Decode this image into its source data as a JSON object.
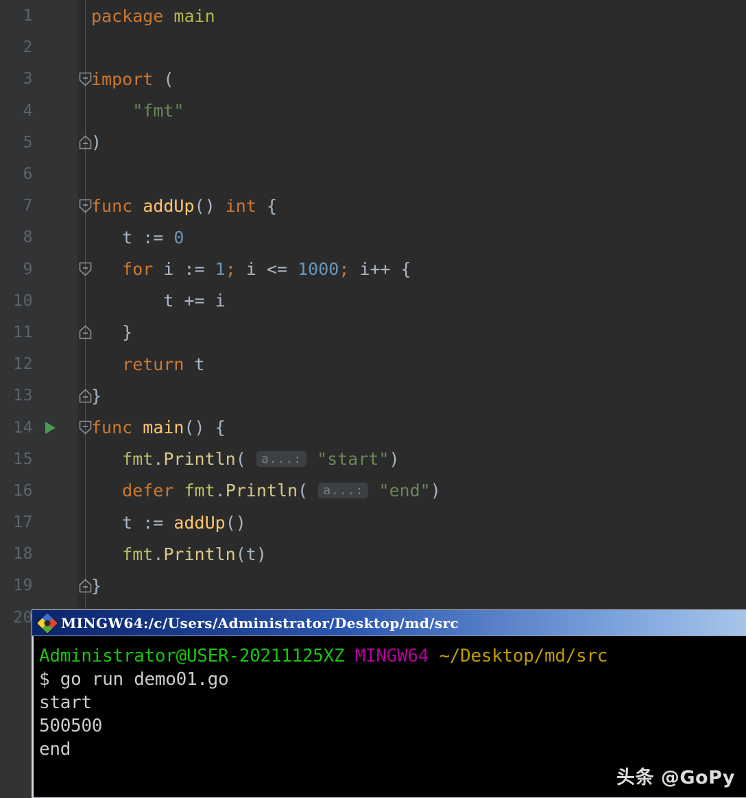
{
  "editor": {
    "language": "Go",
    "background": "#2b2b2b",
    "gutter_background": "#313335",
    "line_number_color": "#606366",
    "run_marker_color": "#499c54",
    "lines": [
      {
        "n": "1",
        "fold": "none",
        "run": false
      },
      {
        "n": "2",
        "fold": "none",
        "run": false
      },
      {
        "n": "3",
        "fold": "start",
        "run": false
      },
      {
        "n": "4",
        "fold": "none",
        "run": false
      },
      {
        "n": "5",
        "fold": "end",
        "run": false
      },
      {
        "n": "6",
        "fold": "none",
        "run": false
      },
      {
        "n": "7",
        "fold": "start",
        "run": false
      },
      {
        "n": "8",
        "fold": "none",
        "run": false
      },
      {
        "n": "9",
        "fold": "start",
        "run": false
      },
      {
        "n": "10",
        "fold": "none",
        "run": false
      },
      {
        "n": "11",
        "fold": "end",
        "run": false
      },
      {
        "n": "12",
        "fold": "none",
        "run": false
      },
      {
        "n": "13",
        "fold": "end",
        "run": false
      },
      {
        "n": "14",
        "fold": "start",
        "run": true
      },
      {
        "n": "15",
        "fold": "none",
        "run": false
      },
      {
        "n": "16",
        "fold": "none",
        "run": false
      },
      {
        "n": "17",
        "fold": "none",
        "run": false
      },
      {
        "n": "18",
        "fold": "none",
        "run": false
      },
      {
        "n": "19",
        "fold": "end",
        "run": false
      },
      {
        "n": "20",
        "fold": "none",
        "run": false
      }
    ],
    "source_text": "package main\n\nimport (\n    \"fmt\"\n)\n\nfunc addUp() int {\n    t := 0\n    for i := 1; i <= 1000; i++ {\n        t += i\n    }\n    return t\n}\nfunc main() {\n    fmt.Println(a...: \"start\")\n    defer fmt.Println(a...: \"end\")\n    t := addUp()\n    fmt.Println(t)\n}\n",
    "inline_hint_label": "a...:",
    "colors": {
      "keyword": "#cc7832",
      "function": "#ffc66d",
      "string": "#6a8759",
      "number": "#6897bb",
      "identifier": "#a9b7c6",
      "package": "#b5b84a",
      "hint_bg": "#3c4042",
      "hint_fg": "#787d80"
    }
  },
  "terminal": {
    "title": "MINGW64:/c/Users/Administrator/Desktop/md/src",
    "icon": "mingw-diamond-icon",
    "titlebar_color": "#2d58b0",
    "background": "#000000",
    "prompt": {
      "user_host": "Administrator@USER-20211125XZ",
      "shell": "MINGW64",
      "path": "~/Desktop/md/src",
      "symbol": "$",
      "command": "go run demo01.go"
    },
    "output": [
      "start",
      "500500",
      "end"
    ],
    "colors": {
      "user_host": "#16c60c",
      "shell": "#b4009e",
      "path": "#c19c00",
      "text": "#cccccc"
    }
  },
  "watermark": {
    "text": "头条 @GoPy"
  }
}
